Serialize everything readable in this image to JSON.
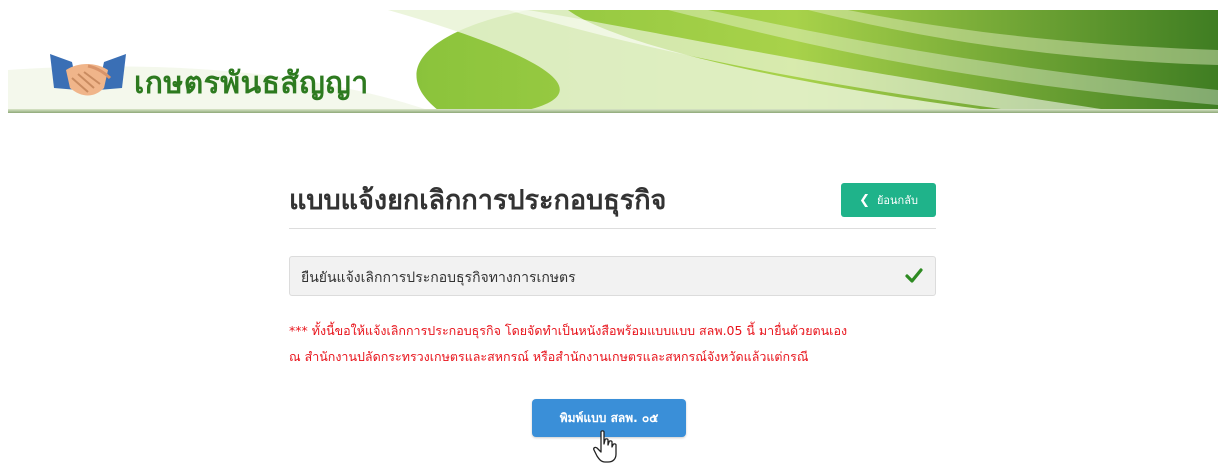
{
  "header": {
    "brand_title": "เกษตรพันธสัญญา",
    "colors": {
      "banner_green": "#5f9d2c",
      "brand_text": "#2d7a1f"
    }
  },
  "main": {
    "page_title": "แบบแจ้งยกเลิกการประกอบธุรกิจ",
    "back_button_label": "ย้อนกลับ",
    "confirm_option": {
      "label": "ยืนยันแจ้งเลิกการประกอบธุรกิจทางการเกษตร",
      "checked": true
    },
    "notice_lines": [
      "*** ทั้งนี้ขอให้แจ้งเลิกการประกอบธุรกิจ โดยจัดทำเป็นหนังสือพร้อมแบบแบบ สลพ.05 นี้ มายื่นด้วยตนเอง",
      "ณ สำนักงานปลัดกระทรวงเกษตรและสหกรณ์ หรือสำนักงานเกษตรและสหกรณ์จังหวัดแล้วแต่กรณี"
    ],
    "print_button_label": "พิมพ์แบบ สลพ. ๐๕",
    "colors": {
      "back_button": "#1fb38a",
      "print_button": "#3a8fd8",
      "notice_text": "#e8131b",
      "check": "#2e8b22"
    }
  },
  "cursor": {
    "icon": "hand-pointer-icon"
  }
}
